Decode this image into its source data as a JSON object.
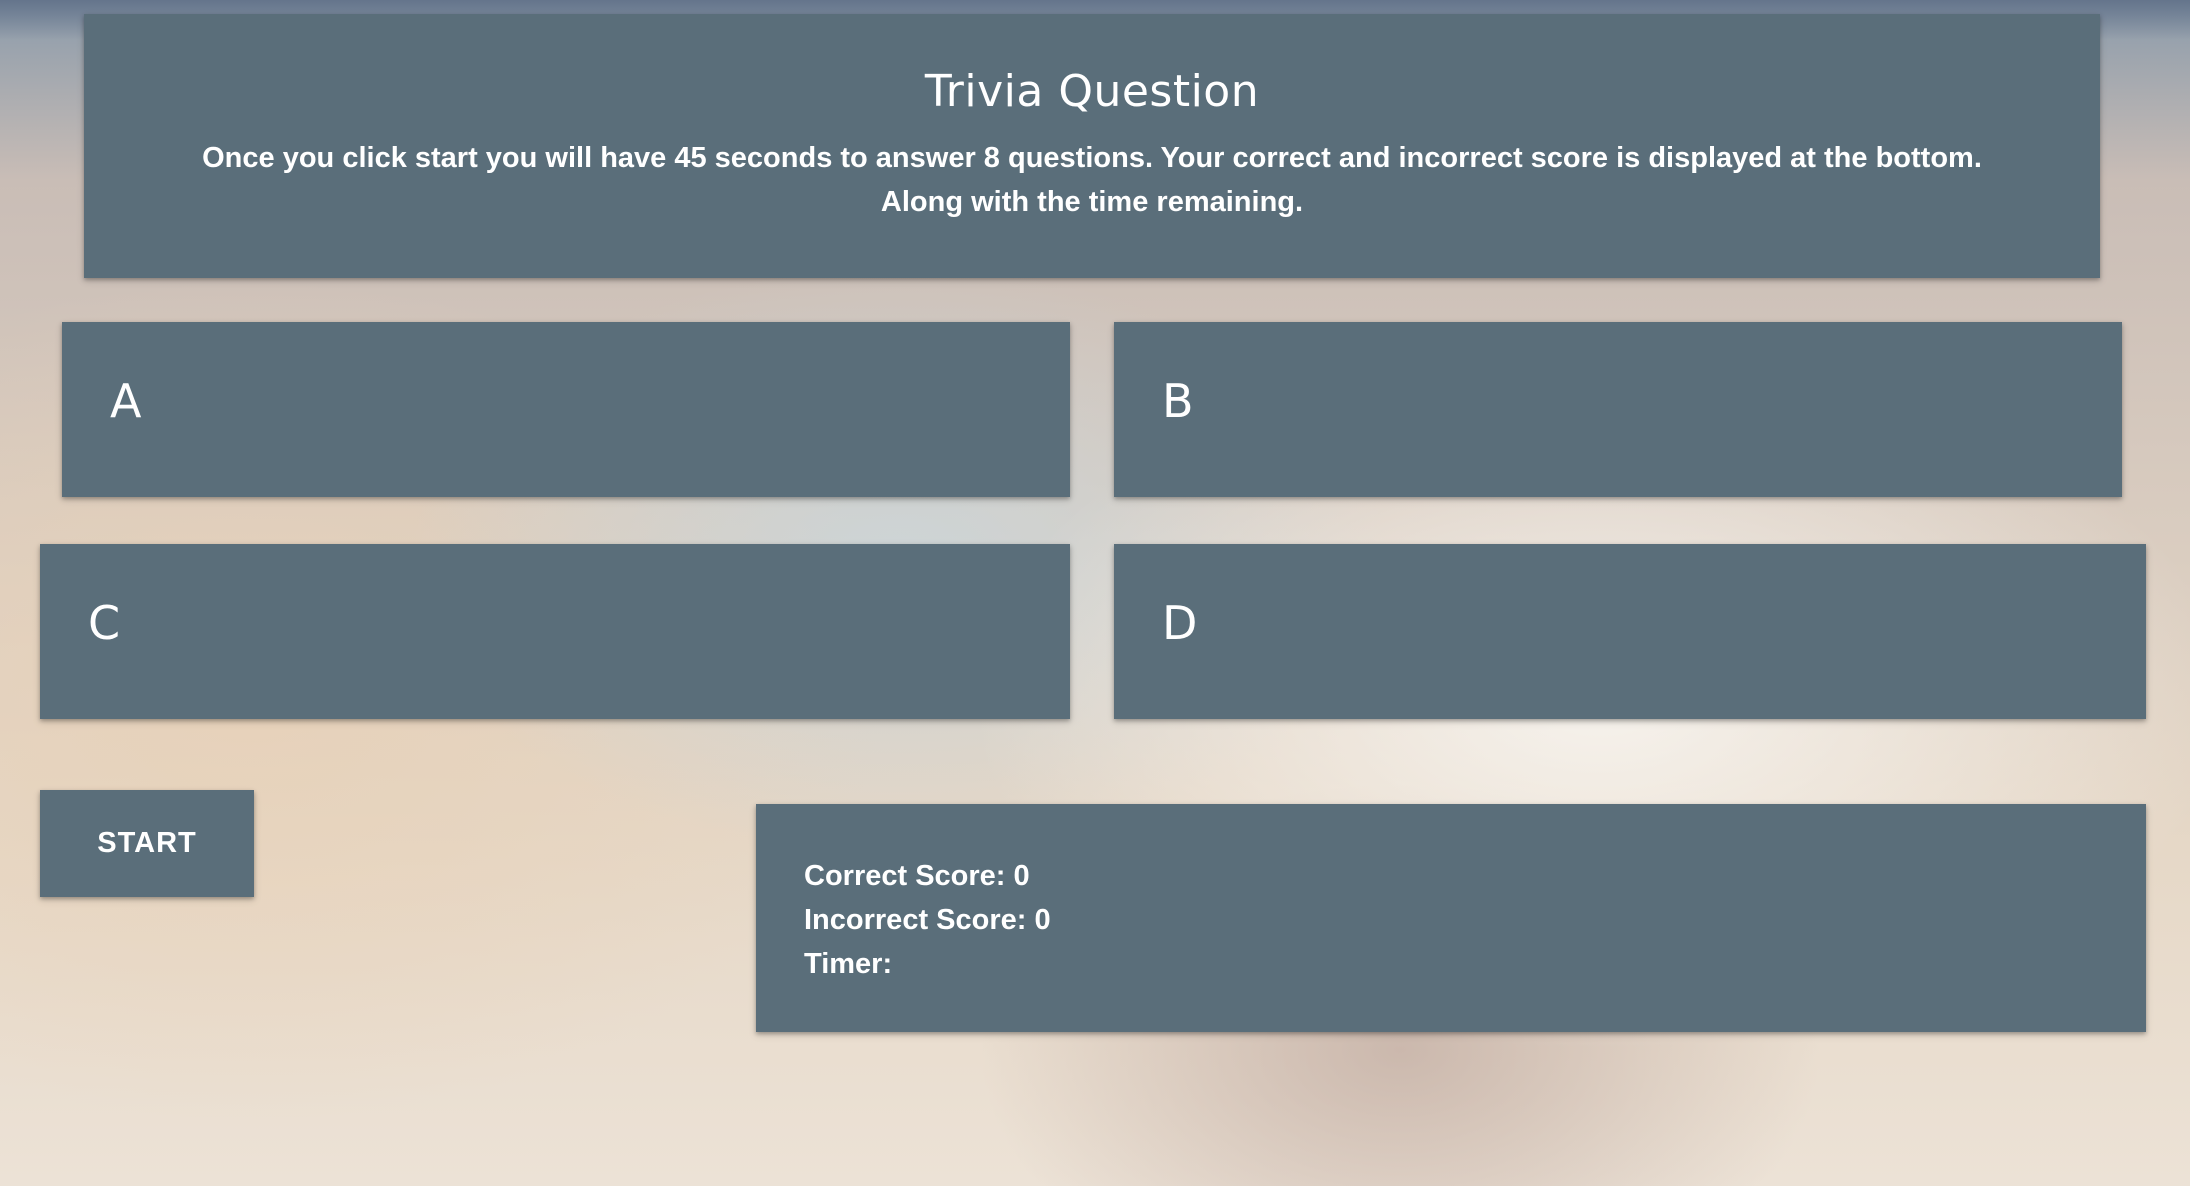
{
  "header": {
    "title": "Trivia Question",
    "instructions": "Once you click start you will have 45 seconds to answer 8 questions. Your correct and incorrect score is displayed at the bottom. Along with the time remaining."
  },
  "answers": [
    {
      "label": "A"
    },
    {
      "label": "B"
    },
    {
      "label": "C"
    },
    {
      "label": "D"
    }
  ],
  "controls": {
    "start_label": "START"
  },
  "scoreboard": {
    "correct": "Correct Score: 0",
    "incorrect": "Incorrect Score: 0",
    "timer": "Timer:"
  }
}
